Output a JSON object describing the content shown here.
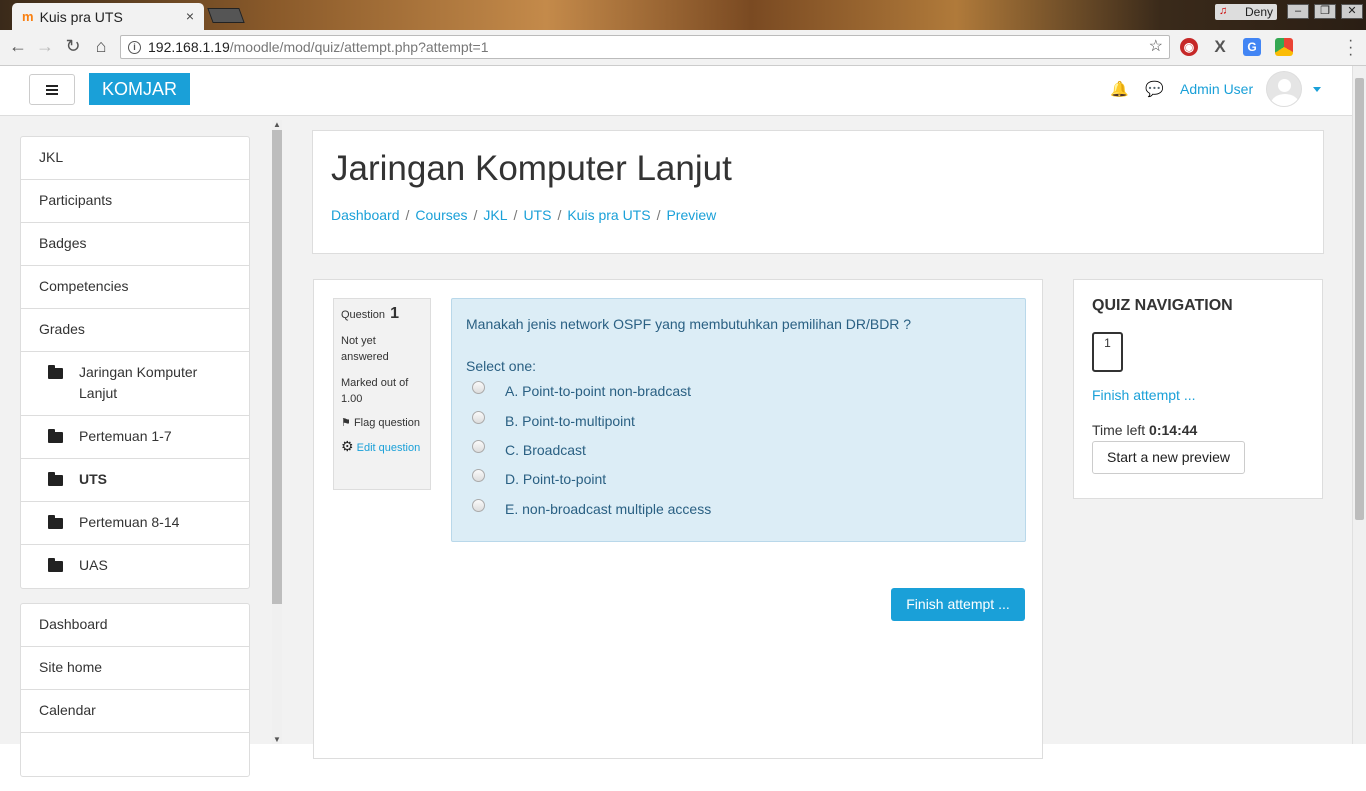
{
  "browser": {
    "tab_title": "Kuis pra UTS",
    "tab_close": "×",
    "profile_name": "Deny",
    "url_host": "192.168.1.19",
    "url_path": "/moodle/mod/quiz/attempt.php?attempt=1",
    "window_buttons": [
      "–",
      "❐",
      "✕"
    ]
  },
  "navbar": {
    "brand": "KOMJAR",
    "user_name": "Admin User"
  },
  "sidebar": {
    "course_items": [
      {
        "label": "JKL"
      },
      {
        "label": "Participants"
      },
      {
        "label": "Badges"
      },
      {
        "label": "Competencies"
      },
      {
        "label": "Grades"
      }
    ],
    "sections": [
      {
        "label": "Jaringan Komputer Lanjut"
      },
      {
        "label": "Pertemuan 1-7"
      },
      {
        "label": "UTS",
        "current": true
      },
      {
        "label": "Pertemuan 8-14"
      },
      {
        "label": "UAS"
      }
    ],
    "site_items": [
      {
        "label": "Dashboard"
      },
      {
        "label": "Site home"
      },
      {
        "label": "Calendar"
      }
    ]
  },
  "page": {
    "title": "Jaringan Komputer Lanjut",
    "breadcrumb": [
      "Dashboard",
      "Courses",
      "JKL",
      "UTS",
      "Kuis pra UTS",
      "Preview"
    ],
    "breadcrumb_sep": "/"
  },
  "question": {
    "label": "Question",
    "number": "1",
    "state": "Not yet answered",
    "marked": "Marked out of 1.00",
    "flag": "Flag question",
    "edit": "Edit question",
    "text": "Manakah jenis network OSPF yang membutuhkan pemilihan DR/BDR ?",
    "select_prompt": "Select one:",
    "options": [
      "A. Point-to-point non-bradcast",
      "B. Point-to-multipoint",
      "C. Broadcast",
      "D. Point-to-point",
      "E. non-broadcast multiple access"
    ],
    "finish_button": "Finish attempt ..."
  },
  "quiz_nav": {
    "heading": "QUIZ NAVIGATION",
    "question_button": "1",
    "finish_link": "Finish attempt ...",
    "time_left_label": "Time left",
    "time_left_value": "0:14:44",
    "new_preview_button": "Start a new preview"
  },
  "colors": {
    "accent": "#1aa0d8",
    "question_bg": "#dcedf6",
    "page_bg": "#f2f2f2"
  }
}
